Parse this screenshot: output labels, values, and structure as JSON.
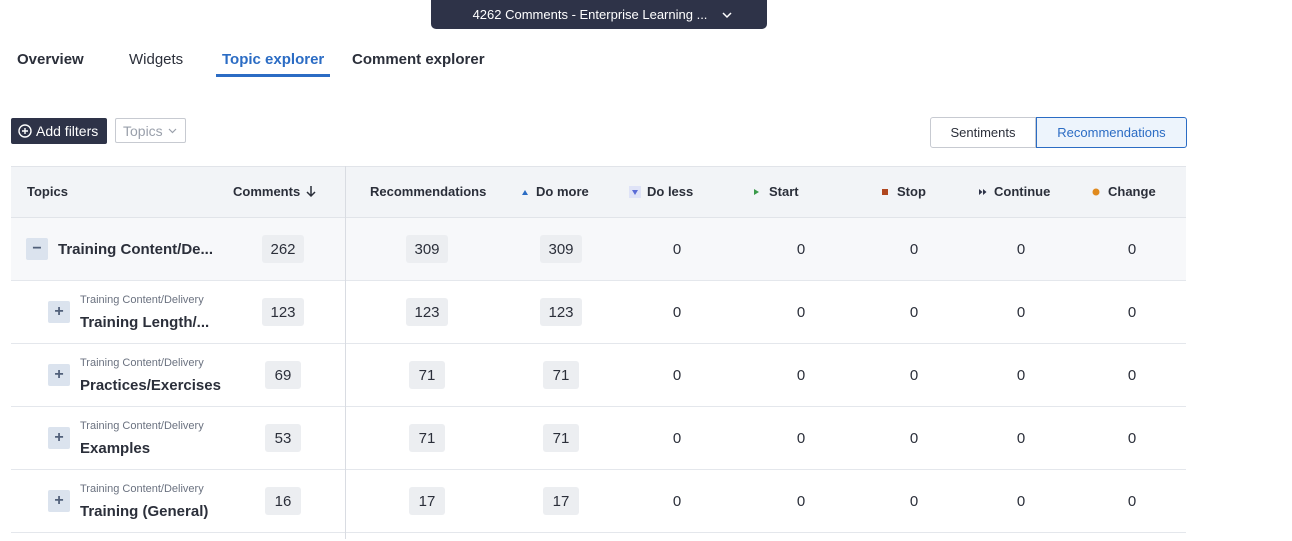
{
  "header": {
    "dataset_label": "4262 Comments - Enterprise Learning ..."
  },
  "tabs": [
    {
      "label": "Overview"
    },
    {
      "label": "Widgets"
    },
    {
      "label": "Topic explorer"
    },
    {
      "label": "Comment explorer"
    }
  ],
  "toolbar": {
    "add_filters_label": "Add filters",
    "topics_placeholder": "Topics",
    "view_toggle": [
      {
        "label": "Sentiments"
      },
      {
        "label": "Recommendations"
      }
    ],
    "active_view": "Recommendations"
  },
  "table": {
    "columns": [
      "Topics",
      "Comments",
      "Recommendations",
      "Do more",
      "Do less",
      "Start",
      "Stop",
      "Continue",
      "Change"
    ],
    "sort_column": "Comments",
    "legend_colors": {
      "do_more": "#2b6cc4",
      "do_less": "#5a6bd6",
      "start": "#3a9a4a",
      "stop": "#b0471f",
      "continue": "#2e3348",
      "change": "#e08a1e"
    },
    "rows": [
      {
        "type": "parent",
        "parent": "",
        "name": "Training Content/De...",
        "comments": "262",
        "recommendations": "309",
        "do_more": "309",
        "do_less": "0",
        "start": "0",
        "stop": "0",
        "continue": "0",
        "change": "0"
      },
      {
        "type": "child",
        "parent": "Training Content/Delivery",
        "name": "Training Length/...",
        "comments": "123",
        "recommendations": "123",
        "do_more": "123",
        "do_less": "0",
        "start": "0",
        "stop": "0",
        "continue": "0",
        "change": "0"
      },
      {
        "type": "child",
        "parent": "Training Content/Delivery",
        "name": "Practices/Exercises",
        "comments": "69",
        "recommendations": "71",
        "do_more": "71",
        "do_less": "0",
        "start": "0",
        "stop": "0",
        "continue": "0",
        "change": "0"
      },
      {
        "type": "child",
        "parent": "Training Content/Delivery",
        "name": "Examples",
        "comments": "53",
        "recommendations": "71",
        "do_more": "71",
        "do_less": "0",
        "start": "0",
        "stop": "0",
        "continue": "0",
        "change": "0"
      },
      {
        "type": "child",
        "parent": "Training Content/Delivery",
        "name": "Training (General)",
        "comments": "16",
        "recommendations": "17",
        "do_more": "17",
        "do_less": "0",
        "start": "0",
        "stop": "0",
        "continue": "0",
        "change": "0"
      }
    ]
  }
}
